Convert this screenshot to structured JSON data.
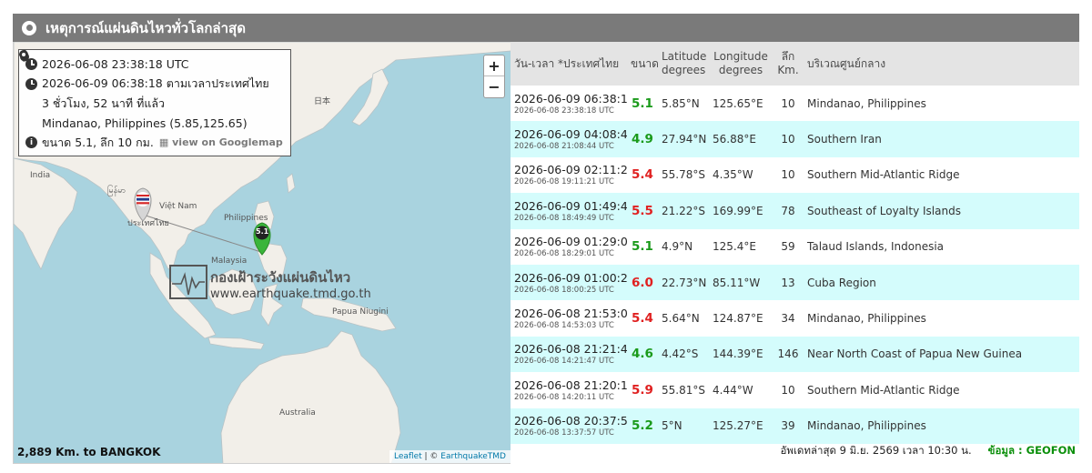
{
  "header": {
    "title": "เหตุการณ์แผ่นดินไหวทั่วโลกล่าสุด"
  },
  "info": {
    "utc": "2026-06-08 23:38:18 UTC",
    "local": "2026-06-09 06:38:18 ตามเวลาประเทศไทย",
    "ago": "3 ชั่วโมง, 52 นาที ที่แล้ว",
    "location": "Mindanao, Philippines (5.85,125.65)",
    "detail": "ขนาด 5.1, ลึก 10 กม.",
    "map_link": "view on Googlemap"
  },
  "map": {
    "zoom_in": "+",
    "zoom_out": "−",
    "labels": {
      "japan": "日本",
      "india": "India",
      "myanmar": "မြန်မာ",
      "thailand": "ประเทศไทย",
      "vietnam": "Việt Nam",
      "philippines": "Philippines",
      "malaysia": "Malaysia",
      "png": "Papua Niugini",
      "australia": "Australia"
    },
    "marker_value": "5.1",
    "watermark_title": "กองเฝ้าระวังแผ่นดินไหว",
    "watermark_url": "www.earthquake.tmd.go.th",
    "distance": "2,889 Km. to BANGKOK",
    "attr_leaflet": "Leaflet",
    "attr_sep": " | © ",
    "attr_owner": "EarthquakeTMD"
  },
  "table": {
    "headers": {
      "time": "วัน-เวลา *ประเทศไทย",
      "mag": "ขนาด",
      "lat": "Latitude degrees",
      "lon": "Longitude degrees",
      "depth": "ลึก Km.",
      "region": "บริเวณศูนย์กลาง"
    },
    "rows": [
      {
        "local": "2026-06-09 06:38:18",
        "utc": "2026-06-08 23:38:18 UTC",
        "mag": "5.1",
        "lat": "5.85°N",
        "lon": "125.65°E",
        "depth": "10",
        "region": "Mindanao, Philippines"
      },
      {
        "local": "2026-06-09 04:08:44",
        "utc": "2026-06-08 21:08:44 UTC",
        "mag": "4.9",
        "lat": "27.94°N",
        "lon": "56.88°E",
        "depth": "10",
        "region": "Southern Iran"
      },
      {
        "local": "2026-06-09 02:11:21",
        "utc": "2026-06-08 19:11:21 UTC",
        "mag": "5.4",
        "lat": "55.78°S",
        "lon": "4.35°W",
        "depth": "10",
        "region": "Southern Mid-Atlantic Ridge"
      },
      {
        "local": "2026-06-09 01:49:49",
        "utc": "2026-06-08 18:49:49 UTC",
        "mag": "5.5",
        "lat": "21.22°S",
        "lon": "169.99°E",
        "depth": "78",
        "region": "Southeast of Loyalty Islands"
      },
      {
        "local": "2026-06-09 01:29:01",
        "utc": "2026-06-08 18:29:01 UTC",
        "mag": "5.1",
        "lat": "4.9°N",
        "lon": "125.4°E",
        "depth": "59",
        "region": "Talaud Islands, Indonesia"
      },
      {
        "local": "2026-06-09 01:00:25",
        "utc": "2026-06-08 18:00:25 UTC",
        "mag": "6.0",
        "lat": "22.73°N",
        "lon": "85.11°W",
        "depth": "13",
        "region": "Cuba Region"
      },
      {
        "local": "2026-06-08 21:53:03",
        "utc": "2026-06-08 14:53:03 UTC",
        "mag": "5.4",
        "lat": "5.64°N",
        "lon": "124.87°E",
        "depth": "34",
        "region": "Mindanao, Philippines"
      },
      {
        "local": "2026-06-08 21:21:47",
        "utc": "2026-06-08 14:21:47 UTC",
        "mag": "4.6",
        "lat": "4.42°S",
        "lon": "144.39°E",
        "depth": "146",
        "region": "Near North Coast of Papua New Guinea"
      },
      {
        "local": "2026-06-08 21:20:11",
        "utc": "2026-06-08 14:20:11 UTC",
        "mag": "5.9",
        "lat": "55.81°S",
        "lon": "4.44°W",
        "depth": "10",
        "region": "Southern Mid-Atlantic Ridge"
      },
      {
        "local": "2026-06-08 20:37:57",
        "utc": "2026-06-08 13:37:57 UTC",
        "mag": "5.2",
        "lat": "5°N",
        "lon": "125.27°E",
        "depth": "39",
        "region": "Mindanao, Philippines"
      }
    ]
  },
  "footer": {
    "updated": "อัพเดทล่าสุด 9 มิ.ย. 2569 เวลา 10:30 น.",
    "source": "ข้อมูล : GEOFON"
  },
  "colors": {
    "green": "#1a9a1a",
    "red": "#e02020",
    "row_alt": "#d4fcfc",
    "header_bar": "#7a7a7a"
  }
}
